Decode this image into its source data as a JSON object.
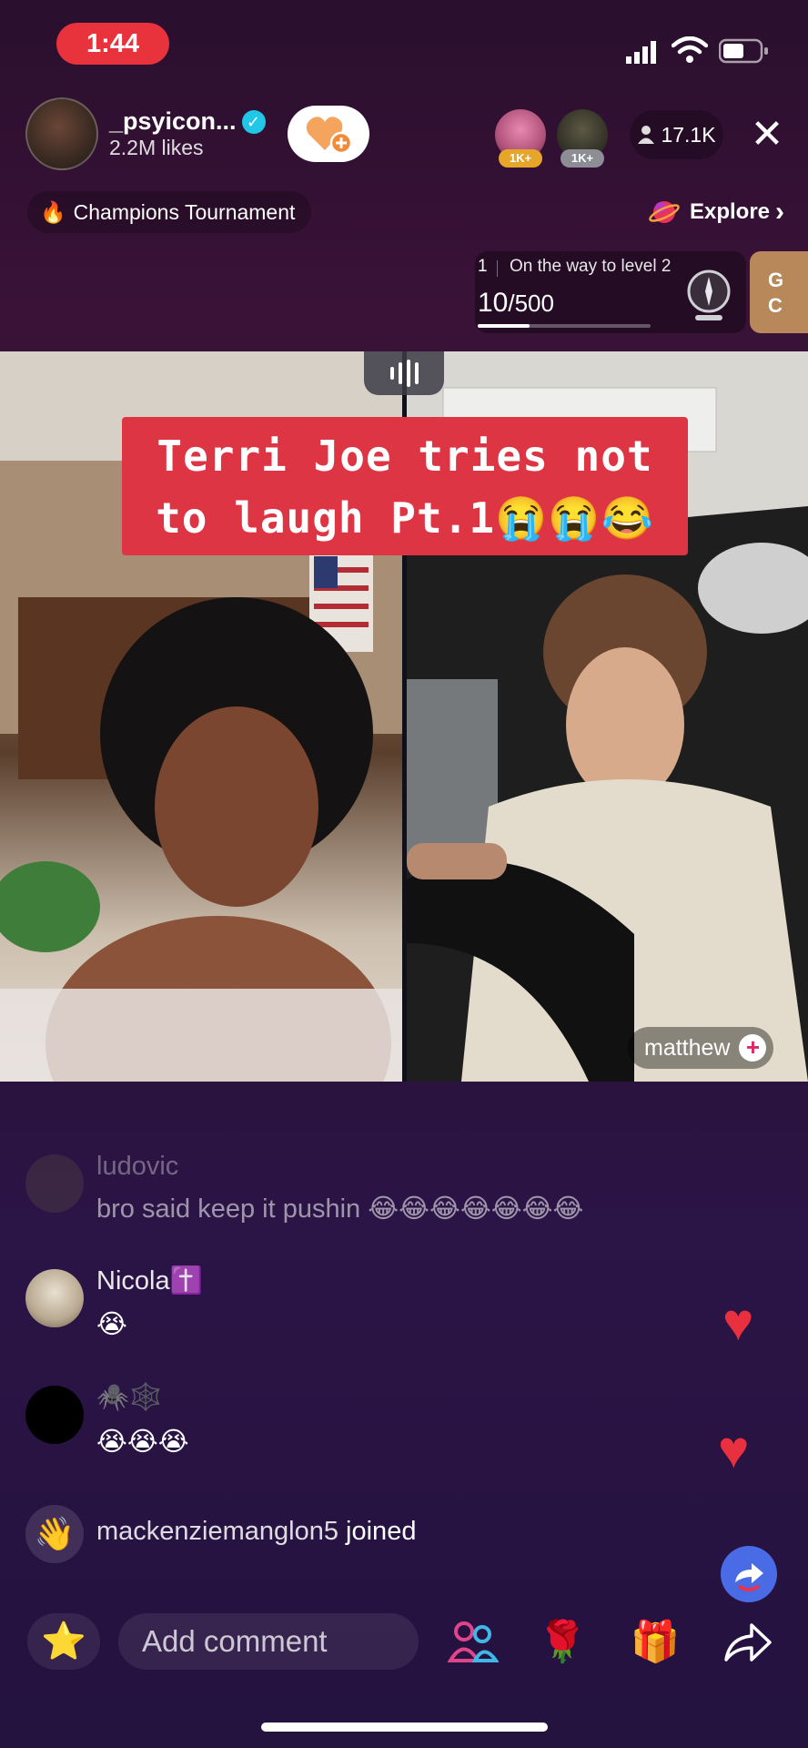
{
  "status_bar": {
    "time": "1:44"
  },
  "host": {
    "name": "_psyicon...",
    "likes": "2.2M likes"
  },
  "top_gifters": [
    {
      "badge": "1K+"
    },
    {
      "badge": "1K+"
    }
  ],
  "viewers": "17.1K",
  "close_glyph": "✕",
  "tournament": {
    "emoji": "🔥",
    "label": "Champions Tournament"
  },
  "explore": {
    "label": "Explore",
    "chevron": "›"
  },
  "level": {
    "number": "1",
    "text": "On the way to level 2",
    "current": "10",
    "total": "/500",
    "progress_fraction": 0.02
  },
  "side_card": {
    "line1": "G",
    "line2": "C"
  },
  "caption": {
    "line1": "Terri Joe tries not",
    "line2": "to laugh Pt.1😭😭😂"
  },
  "guest": {
    "name": "matthew"
  },
  "comments": [
    {
      "user": "ludovic",
      "text": "bro said keep it pushin 😂😂😂😂😂😂😂"
    },
    {
      "user": "Nicola✝️",
      "text": "😭"
    },
    {
      "user": "🕷️🕸️",
      "text": "😭😭😭"
    }
  ],
  "join_event": {
    "user": "mackenziemanglon5",
    "action": "joined"
  },
  "bottom_bar": {
    "comment_placeholder": "Add comment",
    "fav_icon": "⭐",
    "rose_icon": "🌹",
    "gift_icon": "🎁"
  }
}
